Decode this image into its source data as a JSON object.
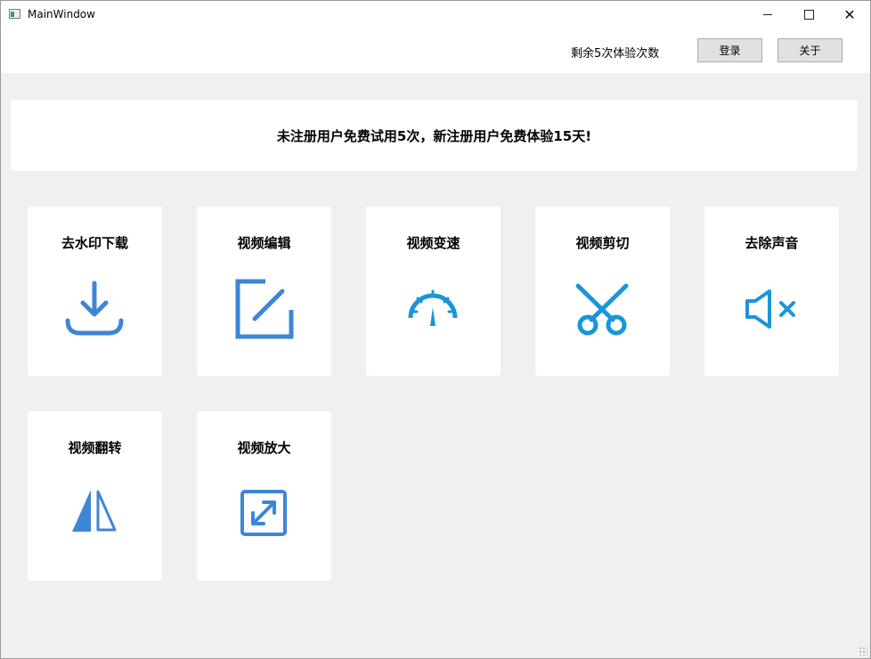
{
  "window": {
    "title": "MainWindow"
  },
  "toolbar": {
    "trial_text": "剩余5次体验次数",
    "login_label": "登录",
    "about_label": "关于"
  },
  "banner": {
    "text": "未注册用户免费试用5次，新注册用户免费体验15天!"
  },
  "cards": [
    {
      "label": "去水印下载",
      "icon": "download-icon"
    },
    {
      "label": "视频编辑",
      "icon": "edit-icon"
    },
    {
      "label": "视频变速",
      "icon": "speedometer-icon"
    },
    {
      "label": "视频剪切",
      "icon": "scissors-icon"
    },
    {
      "label": "去除声音",
      "icon": "mute-icon"
    },
    {
      "label": "视频翻转",
      "icon": "flip-icon"
    },
    {
      "label": "视频放大",
      "icon": "expand-icon"
    }
  ],
  "colors": {
    "icon_blue": "#3d86d6",
    "icon_cyan": "#1a95d8"
  }
}
